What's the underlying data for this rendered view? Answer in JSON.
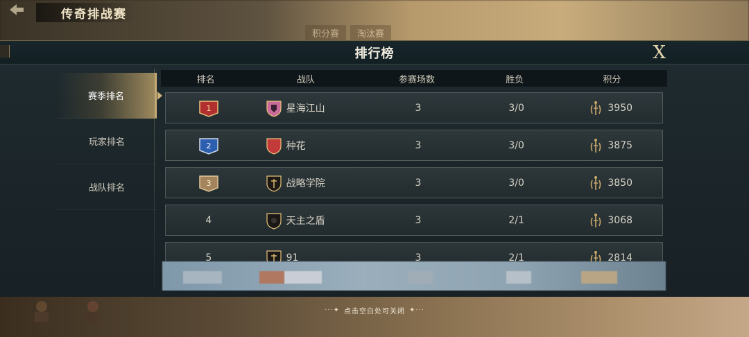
{
  "background": {
    "title": "传奇排战赛",
    "tabs": [
      "积分赛",
      "淘汰赛"
    ]
  },
  "panel": {
    "title": "排行榜",
    "close_label": "X"
  },
  "sidebar": {
    "items": [
      {
        "label": "赛季排名",
        "active": true
      },
      {
        "label": "玩家排名",
        "active": false
      },
      {
        "label": "战队排名",
        "active": false
      }
    ]
  },
  "table": {
    "headers": {
      "rank": "排名",
      "team": "战队",
      "games": "参赛场数",
      "win_loss": "胜负",
      "score": "积分"
    },
    "rows": [
      {
        "rank": "1",
        "team": "星海江山",
        "games": "3",
        "win_loss": "3/0",
        "score": "3950",
        "badge": "gold-1-badge"
      },
      {
        "rank": "2",
        "team": "种花",
        "games": "3",
        "win_loss": "3/0",
        "score": "3875",
        "badge": "silver-2-badge"
      },
      {
        "rank": "3",
        "team": "战略学院",
        "games": "3",
        "win_loss": "3/0",
        "score": "3850",
        "badge": "bronze-3-badge"
      },
      {
        "rank": "4",
        "team": "天主之盾",
        "games": "3",
        "win_loss": "2/1",
        "score": "3068"
      },
      {
        "rank": "5",
        "team": "91",
        "games": "3",
        "win_loss": "2/1",
        "score": "2814"
      }
    ]
  },
  "hint": "点击空白处可关闭",
  "colors": {
    "accent": "#d2b57a",
    "panel_bg": "#1c262a",
    "rank1": "#b22f2f",
    "rank2": "#2d5fb0",
    "rank3": "#a4845c"
  }
}
